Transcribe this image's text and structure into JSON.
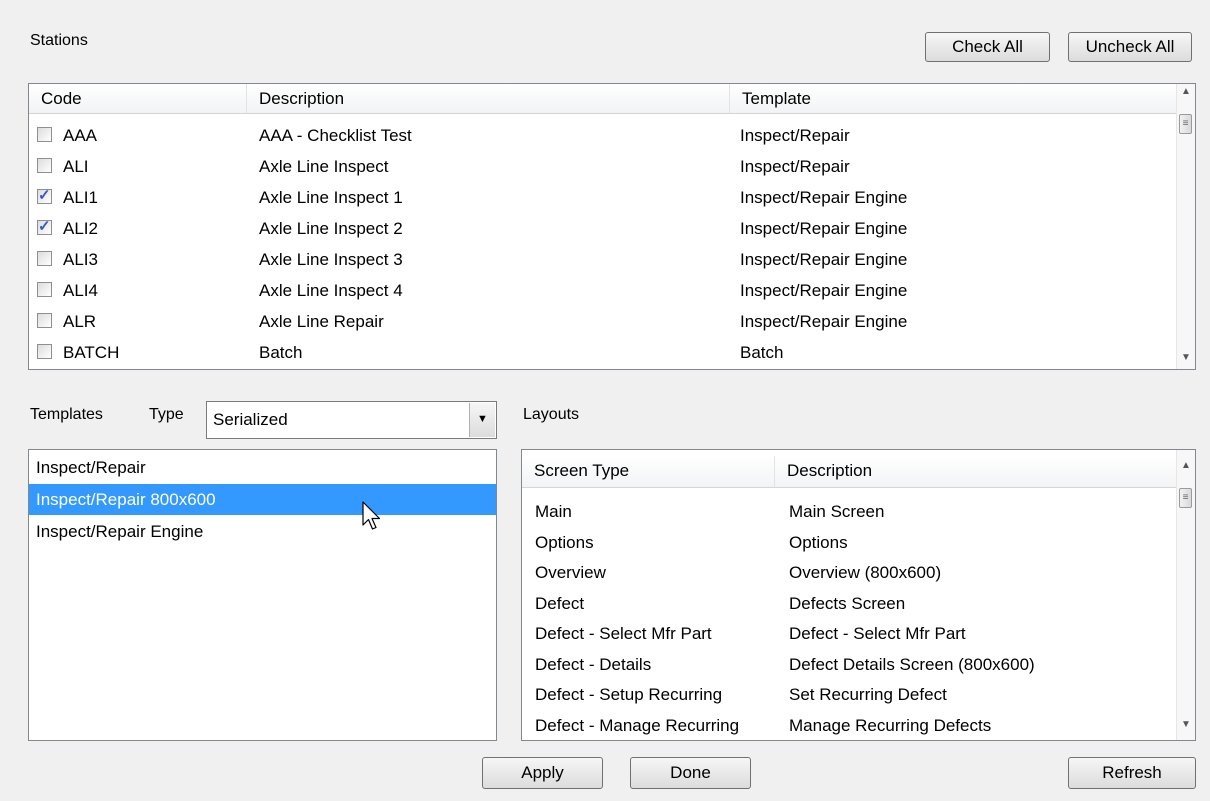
{
  "stations": {
    "label": "Stations",
    "check_all_label": "Check All",
    "uncheck_all_label": "Uncheck All",
    "columns": [
      "Code",
      "Description",
      "Template"
    ],
    "rows": [
      {
        "code": "AAA",
        "description": "AAA - Checklist Test",
        "template": "Inspect/Repair",
        "checked": false
      },
      {
        "code": "ALI",
        "description": "Axle Line Inspect",
        "template": "Inspect/Repair",
        "checked": false
      },
      {
        "code": "ALI1",
        "description": "Axle Line Inspect 1",
        "template": "Inspect/Repair Engine",
        "checked": true
      },
      {
        "code": "ALI2",
        "description": "Axle Line Inspect 2",
        "template": "Inspect/Repair Engine",
        "checked": true
      },
      {
        "code": "ALI3",
        "description": "Axle Line Inspect 3",
        "template": "Inspect/Repair Engine",
        "checked": false
      },
      {
        "code": "ALI4",
        "description": "Axle Line Inspect 4",
        "template": "Inspect/Repair Engine",
        "checked": false
      },
      {
        "code": "ALR",
        "description": "Axle Line Repair",
        "template": "Inspect/Repair Engine",
        "checked": false
      },
      {
        "code": "BATCH",
        "description": "Batch",
        "template": "Batch",
        "checked": false
      }
    ]
  },
  "templates": {
    "label": "Templates",
    "type_label": "Type",
    "type_value": "Serialized",
    "items": [
      "Inspect/Repair",
      "Inspect/Repair 800x600",
      "Inspect/Repair Engine"
    ],
    "selected_index": 1
  },
  "layouts": {
    "label": "Layouts",
    "columns": [
      "Screen Type",
      "Description"
    ],
    "rows": [
      {
        "screen_type": "Main",
        "description": "Main Screen"
      },
      {
        "screen_type": "Options",
        "description": "Options"
      },
      {
        "screen_type": "Overview",
        "description": "Overview (800x600)"
      },
      {
        "screen_type": "Defect",
        "description": "Defects Screen"
      },
      {
        "screen_type": "Defect - Select Mfr Part",
        "description": "Defect - Select Mfr Part"
      },
      {
        "screen_type": "Defect - Details",
        "description": "Defect Details Screen (800x600)"
      },
      {
        "screen_type": "Defect - Setup Recurring",
        "description": "Set Recurring Defect"
      },
      {
        "screen_type": "Defect - Manage Recurring",
        "description": "Manage Recurring Defects"
      }
    ]
  },
  "buttons": {
    "apply": "Apply",
    "done": "Done",
    "refresh": "Refresh"
  },
  "icons": {
    "scroll_up": "up-arrow-icon",
    "scroll_down": "down-arrow-icon",
    "dropdown": "chevron-down-icon",
    "cursor": "mouse-pointer-icon"
  },
  "colors": {
    "selection": "#3399ff",
    "check": "#3a57c0",
    "background": "#f0f0f0"
  }
}
